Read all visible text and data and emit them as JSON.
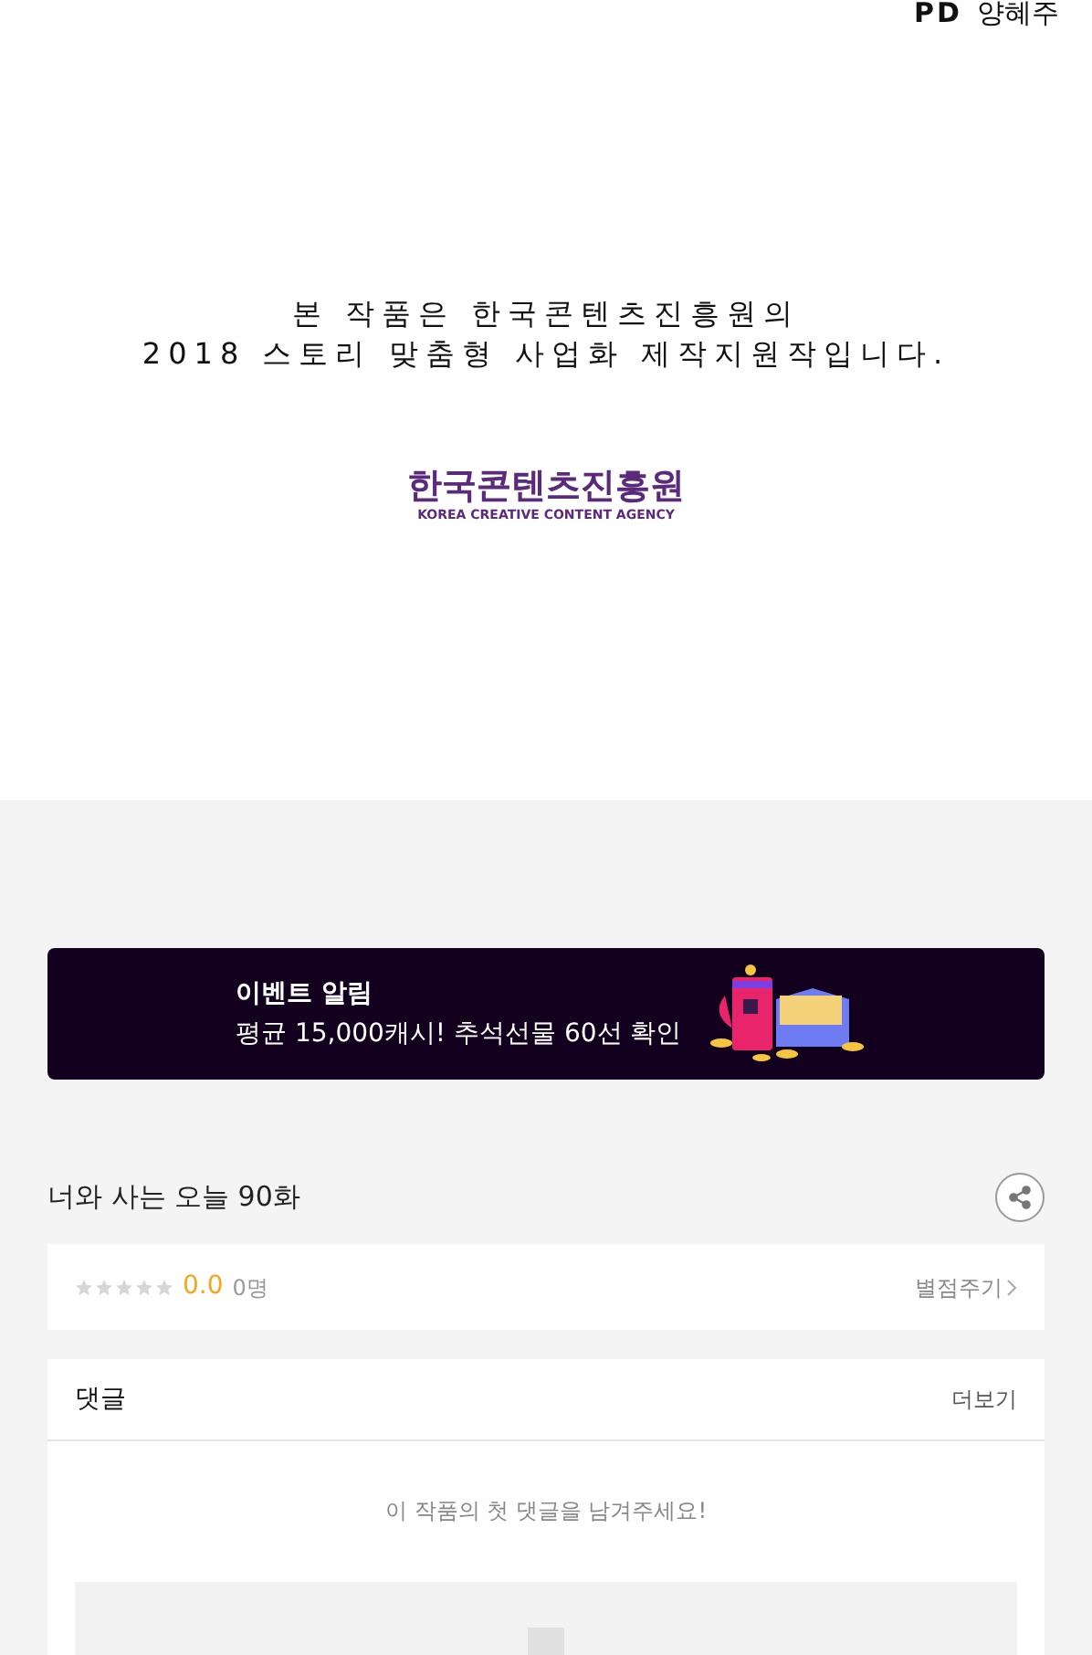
{
  "credits": {
    "role": "PD",
    "name": "양혜주"
  },
  "notice": {
    "lines": [
      "본 작품은 한국콘텐츠진흥원의",
      "2018 스토리 맞춤형 사업화 제작지원작입니다."
    ],
    "logo_title": "한국콘텐츠진흥원",
    "logo_subtitle": "KOREA CREATIVE CONTENT AGENCY"
  },
  "event_banner": {
    "title": "이벤트 알림",
    "text": "평균 15,000캐시! 추석선물 60선 확인"
  },
  "episode": {
    "title": "너와 사는 오늘 90화"
  },
  "rating": {
    "stars": 0,
    "score": "0.0",
    "count": "0명",
    "action": "별점주기"
  },
  "comments": {
    "title": "댓글",
    "more": "더보기",
    "empty_message": "이 작품의 첫 댓글을 남겨주세요!"
  }
}
